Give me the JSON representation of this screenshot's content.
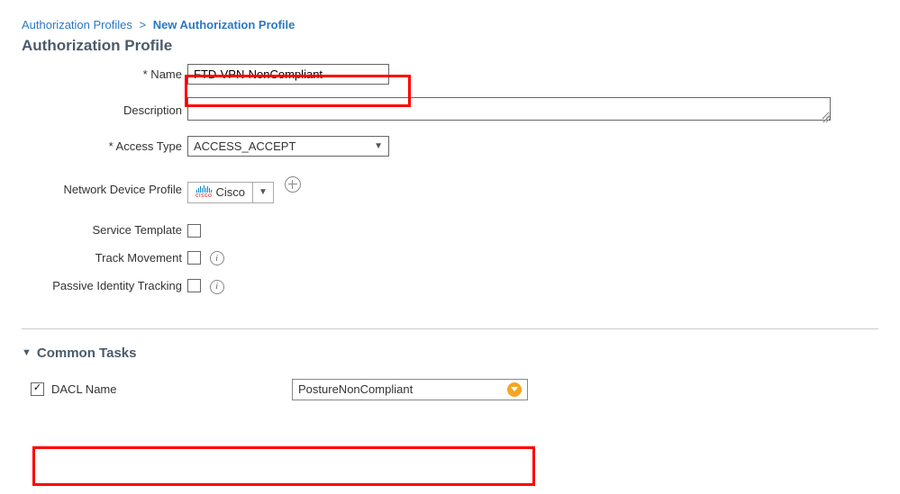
{
  "breadcrumb": {
    "parent": "Authorization Profiles",
    "separator": ">",
    "current": "New Authorization Profile"
  },
  "page_title": "Authorization Profile",
  "fields": {
    "name": {
      "label": "* Name",
      "value": "FTD-VPN-NonCompliant"
    },
    "description": {
      "label": "Description",
      "value": ""
    },
    "access_type": {
      "label": "* Access Type",
      "value": "ACCESS_ACCEPT"
    },
    "ndp": {
      "label": "Network Device Profile",
      "value": "Cisco"
    },
    "service_template": {
      "label": "Service Template",
      "checked": false
    },
    "track_movement": {
      "label": "Track Movement",
      "checked": false
    },
    "passive_identity": {
      "label": "Passive Identity Tracking",
      "checked": false
    }
  },
  "sections": {
    "common_tasks": {
      "title": "Common Tasks",
      "dacl": {
        "label": "DACL Name",
        "checked": true,
        "value": "PostureNonCompliant"
      }
    }
  }
}
